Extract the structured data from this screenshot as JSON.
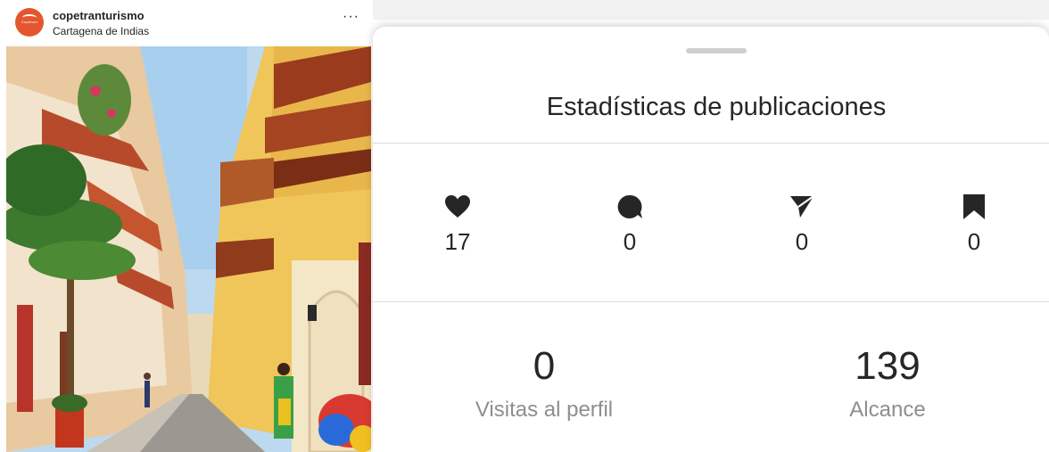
{
  "post": {
    "username": "copetranturismo",
    "location": "Cartagena de Indias",
    "avatar_text": "Copetran",
    "more_icon": "more-horizontal-icon",
    "more_label": "···"
  },
  "sheet": {
    "title": "Estadísticas de publicaciones",
    "interactions": [
      {
        "icon": "heart-icon",
        "value": "17"
      },
      {
        "icon": "comment-icon",
        "value": "0"
      },
      {
        "icon": "share-icon",
        "value": "0"
      },
      {
        "icon": "bookmark-icon",
        "value": "0"
      }
    ],
    "profile_visits": {
      "value": "0",
      "label": "Visitas al perfil"
    },
    "reach": {
      "value": "139",
      "label": "Alcance"
    }
  },
  "colors": {
    "brand": "#e4572e",
    "text": "#262626",
    "muted": "#8e8e8e"
  }
}
